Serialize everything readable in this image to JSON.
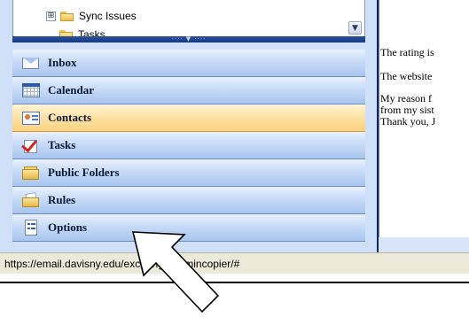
{
  "folder_tree": {
    "items": [
      {
        "label": "Sync Issues",
        "expand": "⊞",
        "icon": "folder-icon"
      },
      {
        "label": "Tasks",
        "icon": "tasks-folder-icon"
      }
    ],
    "scroll_icon": "chevron-down-icon",
    "splitter_label": "···· ▼ ····"
  },
  "nav_buttons": [
    {
      "label": "Inbox",
      "icon": "inbox-icon",
      "active": false
    },
    {
      "label": "Calendar",
      "icon": "calendar-icon",
      "active": false
    },
    {
      "label": "Contacts",
      "icon": "contacts-icon",
      "active": true
    },
    {
      "label": "Tasks",
      "icon": "tasks-icon",
      "active": false
    },
    {
      "label": "Public Folders",
      "icon": "public-folders-icon",
      "active": false
    },
    {
      "label": "Rules",
      "icon": "rules-icon",
      "active": false
    },
    {
      "label": "Options",
      "icon": "options-icon",
      "active": false
    }
  ],
  "message": {
    "line1": "The rating is",
    "line2": "The website",
    "line3": "My reason f",
    "line4": "from my sist",
    "line5": "Thank you, J"
  },
  "status_bar": {
    "url": "https://email.davisny.edu/exchange/admincopier/#"
  },
  "colors": {
    "active_button": "#fbd27c",
    "nav_button": "#a8c5ee",
    "splitter": "#173a82",
    "status_bar": "#ece9d8"
  }
}
